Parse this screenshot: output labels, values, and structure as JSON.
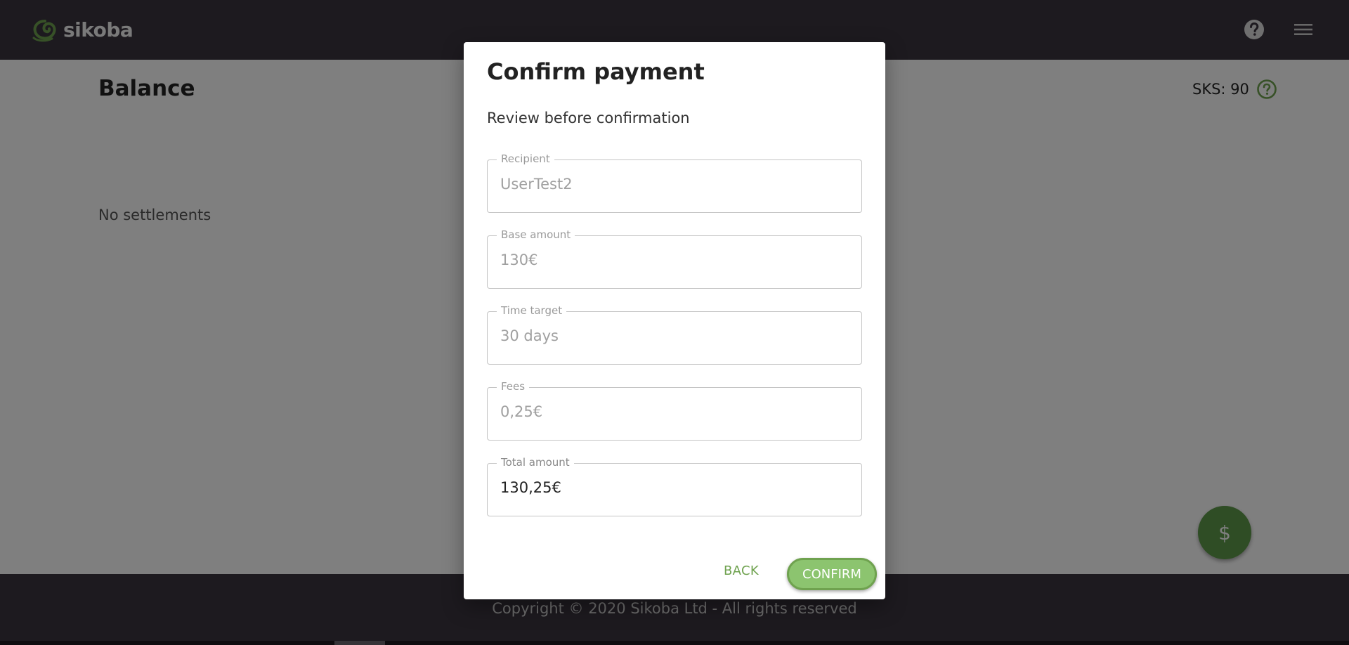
{
  "app": {
    "logo_text": "sikoba",
    "brand_color": "#6fa24f",
    "header_icons": [
      "help-circle-icon",
      "hamburger-menu-icon"
    ]
  },
  "page": {
    "title": "Balance",
    "sks_label": "SKS: 90",
    "sks_icon": "help-circle-icon",
    "empty_text": "No settlements",
    "fab_symbol": "$"
  },
  "footer": {
    "copyright": "Copyright © 2020 Sikoba Ltd - All rights reserved"
  },
  "dialog": {
    "title": "Confirm payment",
    "subtitle": "Review before confirmation",
    "fields": [
      {
        "label": "Recipient",
        "value": "UserTest2"
      },
      {
        "label": "Base amount",
        "value": "130€"
      },
      {
        "label": "Time target",
        "value": "30 days"
      },
      {
        "label": "Fees",
        "value": "0,25€"
      },
      {
        "label": "Total amount",
        "value": "130,25€"
      }
    ],
    "back_label": "BACK",
    "confirm_label": "CONFIRM"
  }
}
